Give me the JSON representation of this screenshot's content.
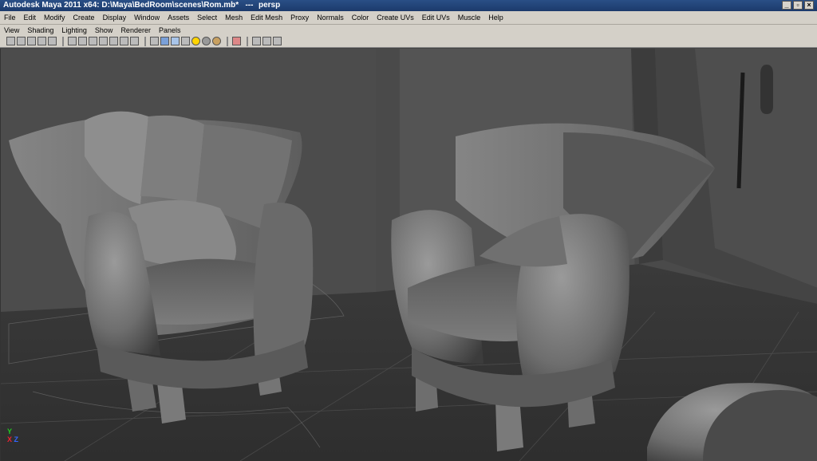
{
  "window": {
    "title": "Autodesk Maya 2011 x64: D:\\Maya\\BedRoom\\scenes\\Rom.mb*   ---",
    "view_name": "persp"
  },
  "menubar": [
    "File",
    "Edit",
    "Modify",
    "Create",
    "Display",
    "Window",
    "Assets",
    "Select",
    "Mesh",
    "Edit Mesh",
    "Proxy",
    "Normals",
    "Color",
    "Create UVs",
    "Edit UVs",
    "Muscle",
    "Help"
  ],
  "panel_menu": [
    "View",
    "Shading",
    "Lighting",
    "Show",
    "Renderer",
    "Panels"
  ],
  "axis": {
    "x": "X",
    "y": "Y",
    "z": "Z"
  }
}
